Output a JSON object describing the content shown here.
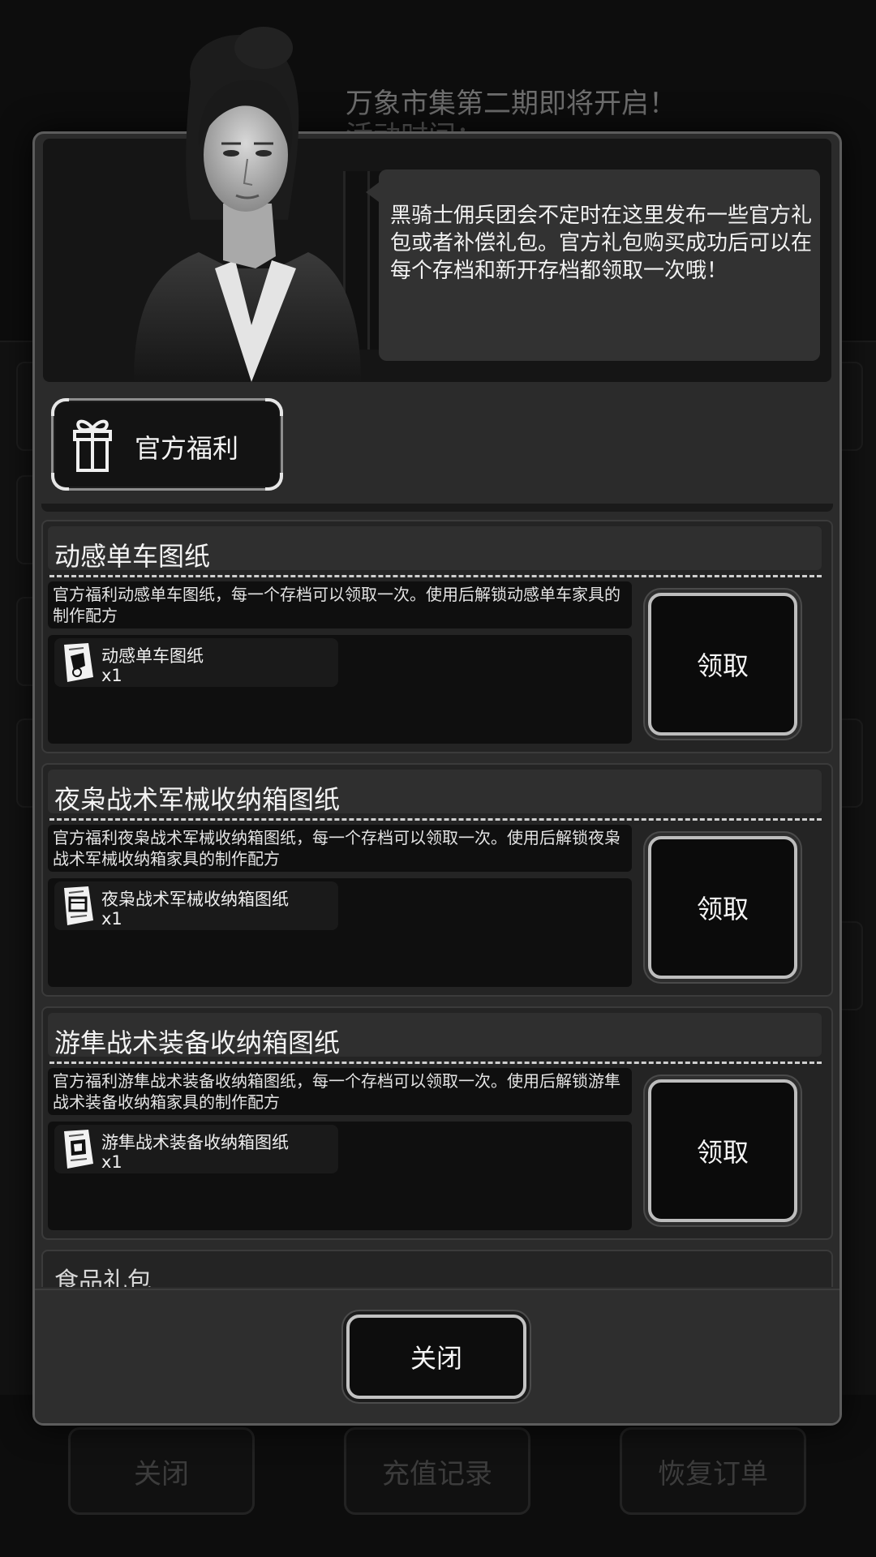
{
  "background": {
    "notice_title": "万象市集第二期即将开启！",
    "notice_sub": "活动时间：",
    "buttons": [
      {
        "label": "关闭"
      },
      {
        "label": "充值记录"
      },
      {
        "label": "恢复订单"
      }
    ]
  },
  "dialog": {
    "speech": "黑骑士佣兵团会不定时在这里发布一些官方礼包或者补偿礼包。官方礼包购买成功后可以在每个存档和新开存档都领取一次哦！",
    "tab": {
      "label": "官方福利",
      "icon": "gift-icon"
    },
    "claim_label": "领取",
    "items": [
      {
        "title": "动感单车图纸",
        "description": "官方福利动感单车图纸，每一个存档可以领取一次。使用后解锁动感单车家具的制作配方",
        "reward_name": "动感单车图纸",
        "reward_qty": "x1"
      },
      {
        "title": "夜枭战术军械收纳箱图纸",
        "description": "官方福利夜枭战术军械收纳箱图纸，每一个存档可以领取一次。使用后解锁夜枭战术军械收纳箱家具的制作配方",
        "reward_name": "夜枭战术军械收纳箱图纸",
        "reward_qty": "x1"
      },
      {
        "title": "游隼战术装备收纳箱图纸",
        "description": "官方福利游隼战术装备收纳箱图纸，每一个存档可以领取一次。使用后解锁游隼战术装备收纳箱家具的制作配方",
        "reward_name": "游隼战术装备收纳箱图纸",
        "reward_qty": "x1"
      }
    ],
    "partial_item_title": "食品礼包",
    "close_label": "关闭"
  }
}
